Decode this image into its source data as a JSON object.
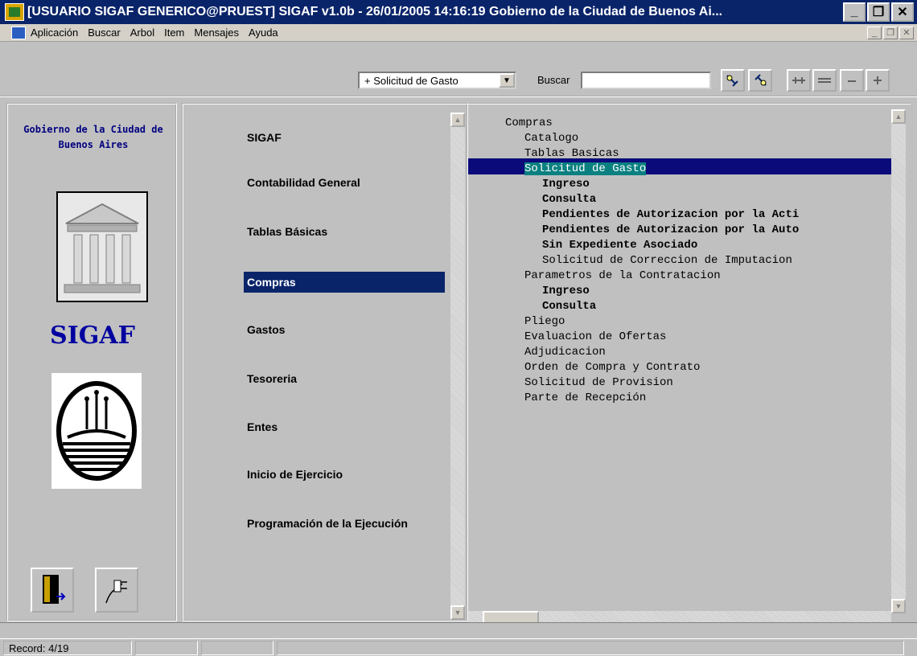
{
  "window": {
    "title": "[USUARIO SIGAF GENERICO@PRUEST]  SIGAF v1.0b - 26/01/2005 14:16:19 Gobierno de la Ciudad de Buenos Ai...",
    "minimize": "_",
    "restore": "❐",
    "close": "✕"
  },
  "menubar": {
    "items": [
      "Aplicación",
      "Buscar",
      "Arbol",
      "Item",
      "Mensajes",
      "Ayuda"
    ]
  },
  "toolbar": {
    "combo_value": "+  Solicitud de Gasto",
    "buscar_label": "Buscar",
    "search_value": ""
  },
  "left": {
    "org_name": "Gobierno de la Ciudad de Buenos Aires",
    "app_name": "SIGAF"
  },
  "nav": {
    "items": [
      "SIGAF",
      "Contabilidad General",
      "Tablas Básicas",
      "Compras",
      "Gastos",
      "Tesoreria",
      "Entes",
      "Inicio de Ejercicio",
      "Programación de la Ejecución"
    ],
    "selected": "Compras"
  },
  "tree": {
    "items": [
      {
        "label": "Compras",
        "level": 0,
        "bold": false
      },
      {
        "label": "Catalogo",
        "level": 1,
        "bold": false
      },
      {
        "label": "Tablas Basicas",
        "level": 1,
        "bold": false
      },
      {
        "label": "Solicitud de Gasto",
        "level": 1,
        "bold": false,
        "selected": true
      },
      {
        "label": "Ingreso",
        "level": 2,
        "bold": true
      },
      {
        "label": "Consulta",
        "level": 2,
        "bold": true
      },
      {
        "label": "Pendientes de Autorizacion por la Acti",
        "level": 2,
        "bold": true
      },
      {
        "label": "Pendientes de Autorizacion por la Auto",
        "level": 2,
        "bold": true
      },
      {
        "label": "Sin Expediente Asociado",
        "level": 2,
        "bold": true
      },
      {
        "label": "Solicitud de Correccion de Imputacion",
        "level": 2,
        "bold": false
      },
      {
        "label": "Parametros de la Contratacion",
        "level": 1,
        "bold": false
      },
      {
        "label": "Ingreso",
        "level": 2,
        "bold": true
      },
      {
        "label": "Consulta",
        "level": 2,
        "bold": true
      },
      {
        "label": "Pliego",
        "level": 1,
        "bold": false
      },
      {
        "label": "Evaluacion de Ofertas",
        "level": 1,
        "bold": false
      },
      {
        "label": "Adjudicacion",
        "level": 1,
        "bold": false
      },
      {
        "label": "Orden de Compra y Contrato",
        "level": 1,
        "bold": false
      },
      {
        "label": "Solicitud de Provision",
        "level": 1,
        "bold": false
      },
      {
        "label": "Parte de Recepción",
        "level": 1,
        "bold": false
      }
    ]
  },
  "status": {
    "record": "Record: 4/19"
  }
}
